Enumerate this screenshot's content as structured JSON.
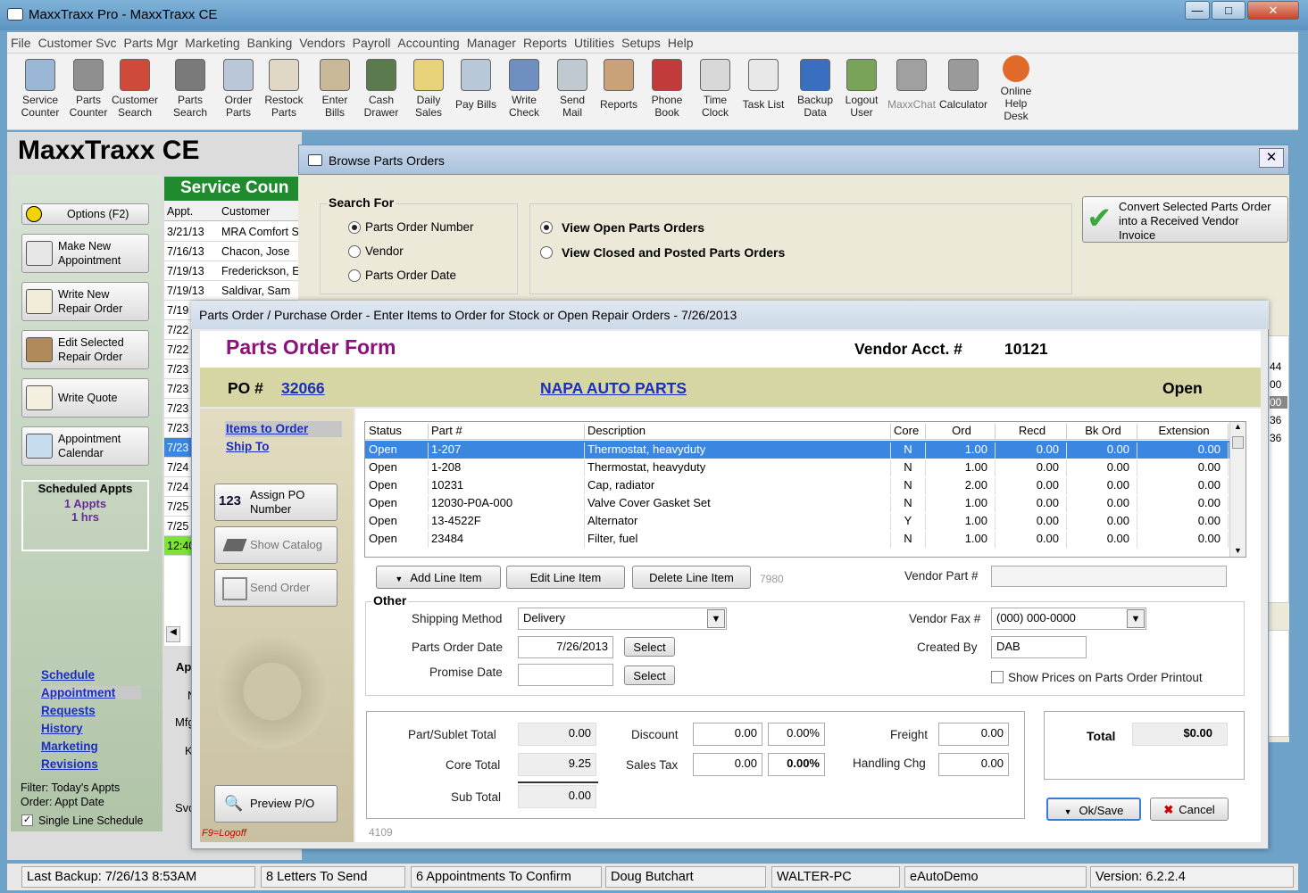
{
  "window": {
    "title": "MaxxTraxx Pro - MaxxTraxx CE",
    "min": "—",
    "max": "□",
    "close": "✕"
  },
  "menu": [
    "File",
    "Customer Svc",
    "Parts Mgr",
    "Marketing",
    "Banking",
    "Vendors",
    "Payroll",
    "Accounting",
    "Manager",
    "Reports",
    "Utilities",
    "Setups",
    "Help"
  ],
  "toolbar": [
    {
      "l1": "Service",
      "l2": "Counter",
      "icon": "service-counter-icon",
      "color": "#9bb7d6"
    },
    {
      "l1": "Parts",
      "l2": "Counter",
      "icon": "parts-counter-icon",
      "color": "#8f8f8f"
    },
    {
      "l1": "Customer",
      "l2": "Search",
      "icon": "customer-search-icon",
      "color": "#d04a3a"
    },
    {
      "l1": "Parts",
      "l2": "Search",
      "icon": "parts-search-icon",
      "color": "#7a7a7a"
    },
    {
      "l1": "Order",
      "l2": "Parts",
      "icon": "order-parts-icon",
      "color": "#b9c7d8"
    },
    {
      "l1": "Restock",
      "l2": "Parts",
      "icon": "restock-parts-icon",
      "color": "#e0d8c4"
    },
    {
      "l1": "Enter",
      "l2": "Bills",
      "icon": "enter-bills-icon",
      "color": "#c8b898"
    },
    {
      "l1": "Cash",
      "l2": "Drawer",
      "icon": "cash-drawer-icon",
      "color": "#5b7a4e"
    },
    {
      "l1": "Daily",
      "l2": "Sales",
      "icon": "daily-sales-icon",
      "color": "#e8d27a"
    },
    {
      "l1": "",
      "l2": "Pay Bills",
      "icon": "pay-bills-icon",
      "color": "#b8c8d8"
    },
    {
      "l1": "Write",
      "l2": "Check",
      "icon": "write-check-icon",
      "color": "#6e8fc0"
    },
    {
      "l1": "Send",
      "l2": "Mail",
      "icon": "send-mail-icon",
      "color": "#c0c8d0"
    },
    {
      "l1": "",
      "l2": "Reports",
      "icon": "reports-icon",
      "color": "#c9a27a"
    },
    {
      "l1": "Phone",
      "l2": "Book",
      "icon": "phone-book-icon",
      "color": "#c23a3a"
    },
    {
      "l1": "Time",
      "l2": "Clock",
      "icon": "time-clock-icon",
      "color": "#d8d8d8"
    },
    {
      "l1": "",
      "l2": "Task List",
      "icon": "task-list-icon",
      "color": "#e8e8e8"
    },
    {
      "l1": "Backup",
      "l2": "Data",
      "icon": "backup-data-icon",
      "color": "#3a6fc0"
    },
    {
      "l1": "Logout",
      "l2": "User",
      "icon": "logout-user-icon",
      "color": "#7aa35a"
    },
    {
      "l1": "",
      "l2": "MaxxChat",
      "icon": "maxxchat-icon",
      "color": "#a0a0a0"
    },
    {
      "l1": "",
      "l2": "Calculator",
      "icon": "calculator-icon",
      "color": "#9a9a9a"
    }
  ],
  "help_desk": {
    "l1": "Online",
    "l2": "Help",
    "l3": "Desk"
  },
  "app_title": "MaxxTraxx CE",
  "sidebar": {
    "options": "Options (F2)",
    "make_appt": [
      "Make  New",
      "Appointment"
    ],
    "write_ro": [
      "Write New",
      "Repair Order"
    ],
    "edit_ro": [
      "Edit Selected",
      "Repair Order"
    ],
    "write_quote": "Write Quote",
    "appt_cal": [
      "Appointment",
      "Calendar"
    ],
    "sched_title": "Scheduled Appts",
    "sched_count": "1 Appts",
    "sched_hrs": "1 hrs",
    "links": [
      "Schedule",
      "Appointment",
      "Requests",
      "History",
      "Marketing",
      "Revisions"
    ],
    "filter": "Filter: Today's Appts",
    "order": "Order: Appt Date",
    "single": "Single Line Schedule"
  },
  "service_counter": {
    "title": "Service Coun",
    "headers": [
      "Appt.",
      "Customer"
    ],
    "rows": [
      [
        "3/21/13",
        "MRA Comfort S"
      ],
      [
        "7/16/13",
        "Chacon, Jose"
      ],
      [
        "7/19/13",
        "Frederickson, E"
      ],
      [
        "7/19/13",
        "Saldivar, Sam"
      ],
      [
        "7/19",
        ""
      ],
      [
        "7/22",
        ""
      ],
      [
        "7/22",
        ""
      ],
      [
        "7/23",
        ""
      ],
      [
        "7/23",
        ""
      ],
      [
        "7/23",
        ""
      ],
      [
        "7/23",
        ""
      ],
      [
        "7/23",
        ""
      ],
      [
        "7/24",
        ""
      ],
      [
        "7/24",
        ""
      ],
      [
        "7/25",
        ""
      ],
      [
        "7/25",
        ""
      ],
      [
        "12:40",
        ""
      ]
    ],
    "partial_labels": [
      "Ap",
      "N",
      "Mfg",
      "K",
      "Svc"
    ],
    "right_nums": [
      "44",
      "00",
      "00",
      "36",
      "36"
    ]
  },
  "browse": {
    "title": "Browse Parts Orders",
    "search_for": "Search For",
    "opts": [
      "Parts Order Number",
      "Vendor",
      "Parts Order Date"
    ],
    "view_open": "View Open Parts Orders",
    "view_closed": "View Closed and Posted Parts Orders",
    "convert": [
      "Convert Selected Parts Order",
      "into a Received Vendor",
      "Invoice"
    ]
  },
  "dialog": {
    "title": "Parts Order / Purchase Order - Enter Items to Order for Stock or Open Repair Orders -  7/26/2013",
    "form_title": "Parts Order Form",
    "vendor_acct_label": "Vendor Acct. #",
    "vendor_acct": "10121",
    "po_label": "PO #",
    "po_number": "32066",
    "vendor_name": "NAPA AUTO PARTS",
    "status": "Open",
    "tab_items": "Items to Order",
    "tab_ship": "Ship To",
    "assign_po": [
      "Assign PO",
      "Number"
    ],
    "assign_icon": "123",
    "show_catalog": "Show Catalog",
    "send_order": "Send Order",
    "preview": "Preview P/O",
    "f9": "F9=Logoff",
    "grid_headers": [
      "Status",
      "Part #",
      "Description",
      "Core",
      "Ord",
      "Recd",
      "Bk Ord",
      "Extension"
    ],
    "rows": [
      [
        "Open",
        "1-207",
        "Thermostat, heavyduty",
        "N",
        "1.00",
        "0.00",
        "0.00",
        "0.00"
      ],
      [
        "Open",
        "1-208",
        "Thermostat, heavyduty",
        "N",
        "1.00",
        "0.00",
        "0.00",
        "0.00"
      ],
      [
        "Open",
        "10231",
        "Cap, radiator",
        "N",
        "2.00",
        "0.00",
        "0.00",
        "0.00"
      ],
      [
        "Open",
        "12030-P0A-000",
        "Valve Cover Gasket Set",
        "N",
        "1.00",
        "0.00",
        "0.00",
        "0.00"
      ],
      [
        "Open",
        "13-4522F",
        "Alternator",
        "Y",
        "1.00",
        "0.00",
        "0.00",
        "0.00"
      ],
      [
        "Open",
        "23484",
        "Filter, fuel",
        "N",
        "1.00",
        "0.00",
        "0.00",
        "0.00"
      ]
    ],
    "add_line": "Add Line Item",
    "edit_line": "Edit Line Item",
    "delete_line": "Delete Line Item",
    "code1": "7980",
    "vendor_part_label": "Vendor Part #",
    "other": "Other",
    "shipping_label": "Shipping Method",
    "shipping_val": "Delivery",
    "po_date_label": "Parts Order Date",
    "po_date": "7/26/2013",
    "select": "Select",
    "promise_label": "Promise Date",
    "fax_label": "Vendor Fax #",
    "fax_val": "(000) 000-0000",
    "created_label": "Created By",
    "created_val": "DAB",
    "show_prices": "Show Prices on Parts Order Printout",
    "part_sublet_label": "Part/Sublet Total",
    "part_sublet": "0.00",
    "core_label": "Core Total",
    "core": "9.25",
    "subtotal_label": "Sub Total",
    "subtotal": "0.00",
    "discount_label": "Discount",
    "discount": "0.00",
    "discount_pct": "0.00%",
    "tax_label": "Sales Tax",
    "tax": "0.00",
    "tax_pct": "0.00%",
    "freight_label": "Freight",
    "freight": "0.00",
    "handling_label": "Handling Chg",
    "handling": "0.00",
    "total_label": "Total",
    "total": "$0.00",
    "ok": "Ok/Save",
    "cancel": "Cancel",
    "code2": "4109"
  },
  "statusbar": [
    "Last Backup:  7/26/13   8:53AM",
    "8 Letters To Send",
    "6 Appointments To Confirm",
    "Doug Butchart",
    "WALTER-PC",
    "eAutoDemo",
    "Version:  6.2.2.4"
  ]
}
